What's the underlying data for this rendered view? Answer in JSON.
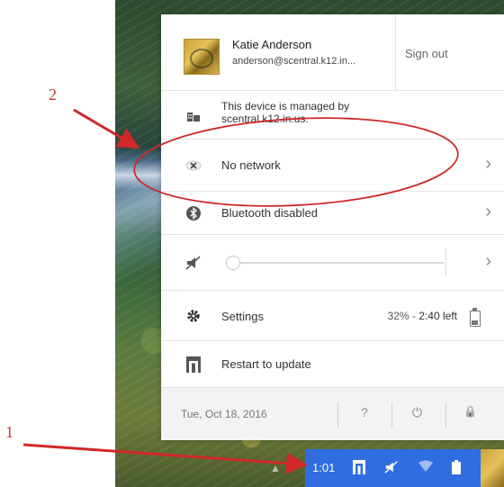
{
  "user": {
    "name": "Katie Anderson",
    "email": "anderson@scentral.k12.in...",
    "sign_out": "Sign out"
  },
  "managed": {
    "text": "This device is managed by scentral.k12.in.us."
  },
  "network": {
    "label": "No network"
  },
  "bluetooth": {
    "label": "Bluetooth disabled"
  },
  "volume": {
    "level": 0
  },
  "settings": {
    "label": "Settings",
    "battery_percent": "32%",
    "battery_sep": "-",
    "battery_time": "2:40 left"
  },
  "update": {
    "label": "Restart to update"
  },
  "footer": {
    "date": "Tue, Oct 18, 2016",
    "help": "?",
    "power": "⏻",
    "lock": "🔒"
  },
  "status_area": {
    "time": "1:01"
  },
  "annotations": {
    "one": "1",
    "two": "2"
  },
  "colors": {
    "status_bg": "#2f6de1",
    "annotation_red": "#c0392b"
  },
  "icons": {
    "managed": "building-icon",
    "network": "no-network-icon",
    "bluetooth": "bluetooth-icon",
    "volume": "speaker-muted-icon",
    "settings": "gear-icon",
    "update": "update-icon",
    "battery": "battery-icon"
  }
}
